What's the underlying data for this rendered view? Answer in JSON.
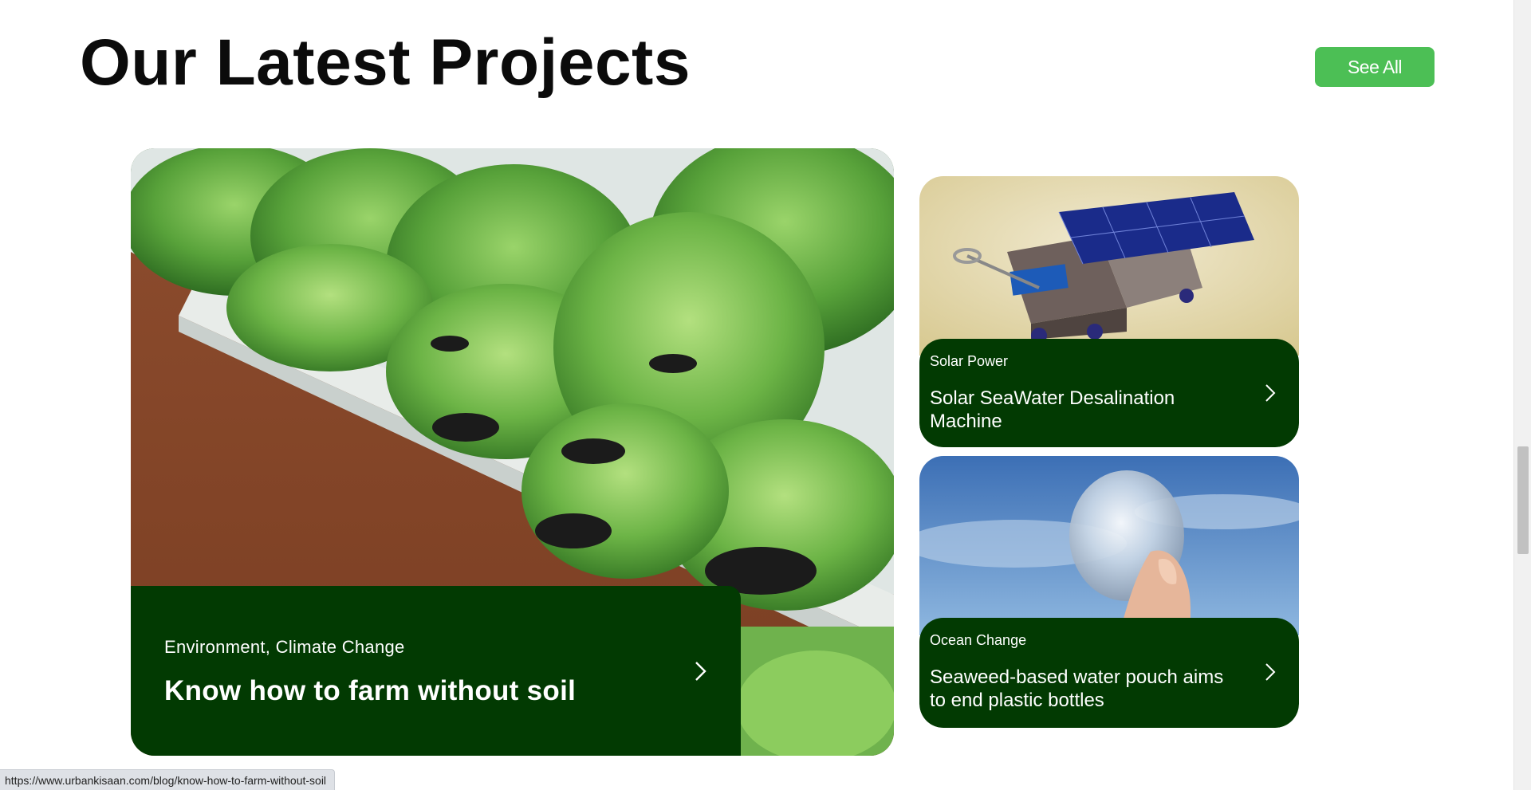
{
  "section": {
    "title": "Our Latest Projects",
    "see_all_label": "See All"
  },
  "featured": {
    "tag": "Environment, Climate Change",
    "title": "Know how to farm without soil"
  },
  "cards": [
    {
      "tag": "Solar Power",
      "title": "Solar SeaWater Desalination Machine"
    },
    {
      "tag": "Ocean Change",
      "title": "Seaweed-based water pouch aims to end plastic bottles"
    }
  ],
  "status_bar": {
    "url": "https://www.urbankisaan.com/blog/know-how-to-farm-without-soil"
  },
  "colors": {
    "accent_green": "#4cbf55",
    "panel_dark_green": "#023a02"
  },
  "icons": {
    "arrow": "chevron-right-icon"
  }
}
